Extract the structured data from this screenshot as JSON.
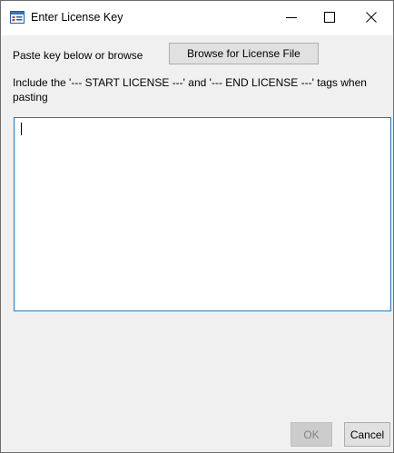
{
  "window": {
    "title": "Enter License Key",
    "app_icon": "window-app-icon",
    "controls": {
      "minimize_icon": "minimize-icon",
      "maximize_icon": "maximize-icon",
      "close_icon": "close-icon"
    }
  },
  "form": {
    "paste_label": "Paste key below or browse",
    "browse_button_label": "Browse for License File",
    "instructions": "Include the '--- START LICENSE ---' and '--- END LICENSE ---' tags when pasting",
    "license_value": ""
  },
  "footer": {
    "ok_label": "OK",
    "ok_enabled": false,
    "cancel_label": "Cancel"
  },
  "colors": {
    "focus_border": "#1e7ac6",
    "disabled_text": "#838383"
  }
}
